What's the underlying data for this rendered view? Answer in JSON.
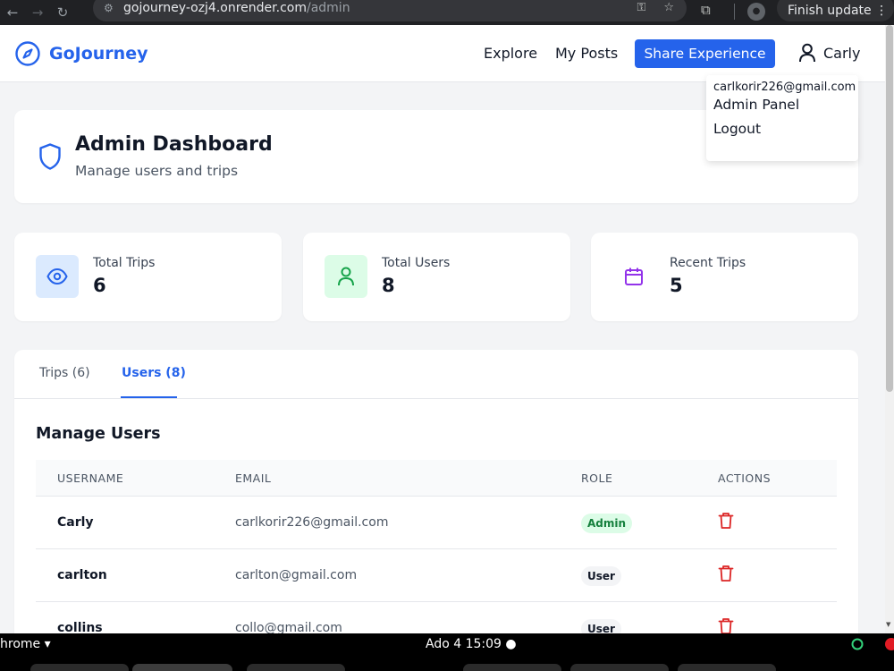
{
  "browser": {
    "url_domain": "gojourney-ozj4.onrender.com",
    "url_path": "/admin",
    "update_label": "Finish update"
  },
  "header": {
    "brand": "GoJourney",
    "nav": {
      "explore": "Explore",
      "my_posts": "My Posts",
      "share": "Share Experience"
    },
    "user": "Carly"
  },
  "dropdown": {
    "email": "carlkorir226@gmail.com",
    "items": [
      "Admin Panel",
      "Logout"
    ]
  },
  "dashboard": {
    "title": "Admin Dashboard",
    "subtitle": "Manage users and trips"
  },
  "stats": [
    {
      "label": "Total Trips",
      "value": "6",
      "icon": "eye-icon",
      "color": "#2563eb",
      "bg": "#dbeafe"
    },
    {
      "label": "Total Users",
      "value": "8",
      "icon": "user-icon",
      "color": "#16a34a",
      "bg": "#dcfce7"
    },
    {
      "label": "Recent Trips",
      "value": "5",
      "icon": "calendar-icon",
      "color": "#9333ea",
      "bg": "#ffffff"
    }
  ],
  "tabs": [
    {
      "label": "Trips (6)",
      "active": false
    },
    {
      "label": "Users (8)",
      "active": true
    }
  ],
  "users_section": {
    "title": "Manage Users",
    "columns": [
      "USERNAME",
      "EMAIL",
      "ROLE",
      "ACTIONS"
    ],
    "rows": [
      {
        "username": "Carly",
        "email": "carlkorir226@gmail.com",
        "role": "Admin"
      },
      {
        "username": "carlton",
        "email": "carlton@gmail.com",
        "role": "User"
      },
      {
        "username": "collins",
        "email": "collo@gmail.com",
        "role": "User"
      }
    ]
  },
  "taskbar": {
    "app": "hrome ▾",
    "clock": "Ado 4  15:09  ●"
  },
  "colors": {
    "primary": "#2563eb",
    "danger": "#dc2626"
  }
}
